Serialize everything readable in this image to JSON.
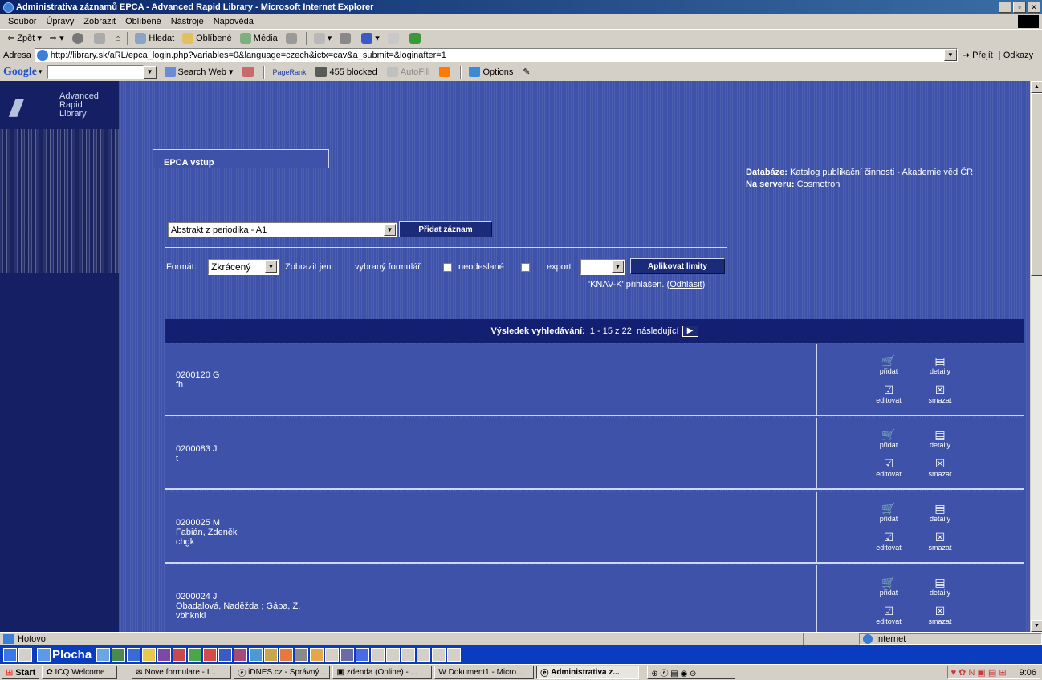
{
  "window": {
    "title": "Administrativa záznamů EPCA - Advanced Rapid Library - Microsoft Internet Explorer"
  },
  "menu": [
    "Soubor",
    "Úpravy",
    "Zobrazit",
    "Oblíbené",
    "Nástroje",
    "Nápověda"
  ],
  "toolbar": {
    "back": "Zpět",
    "search": "Hledat",
    "favorites": "Oblíbené",
    "media": "Média"
  },
  "address": {
    "label": "Adresa",
    "url": "http://library.sk/aRL/epca_login.php?variables=0&language=czech&ictx=cav&a_submit=&loginafter=1",
    "go": "Přejít",
    "links": "Odkazy"
  },
  "google": {
    "logo": "Google",
    "search_web": "Search Web",
    "pagerank": "PageRank",
    "blocked": "455 blocked",
    "autofill": "AutoFill",
    "options": "Options"
  },
  "sidebar": {
    "logo_lines": [
      "Advanced",
      "Rapid",
      "Library"
    ]
  },
  "page": {
    "tab": "EPCA vstup",
    "db_label": "Databáze:",
    "db_value": "Katalog publikační činnosti - Akademie věd ČR",
    "server_label": "Na serveru:",
    "server_value": "Cosmotron",
    "record_type": "Abstrakt z periodika - A1",
    "add_record": "Přidat záznam",
    "format_label": "Formát:",
    "format_value": "Zkrácený",
    "show_only": "Zobrazit jen:",
    "selected_form": "vybraný formulář",
    "unsent": "neodeslané",
    "export": "export",
    "apply_limits": "Aplikovat limity",
    "login_status": "'KNAV-K' přihlášen.",
    "logout": "Odhlásit",
    "results_label": "Výsledek vyhledávání:",
    "results_range": "1 - 15  z 22",
    "next": "následující"
  },
  "actions": {
    "add": "přidat",
    "details": "detaily",
    "edit": "editovat",
    "delete": "smazat"
  },
  "records": [
    {
      "id": "0200120 G",
      "line2": "fh",
      "line3": ""
    },
    {
      "id": "0200083 J",
      "line2": "t",
      "line3": ""
    },
    {
      "id": "0200025 M",
      "line2": "Fabián, Zdeněk",
      "line3": "chgk"
    },
    {
      "id": "0200024 J",
      "line2": "Obadalová, Naděžda ; Gába, Z.",
      "line3": "vbhknkl"
    }
  ],
  "status": {
    "text": "Hotovo",
    "zone": "Internet"
  },
  "quicklaunch": {
    "desktop": "Plocha"
  },
  "taskbar": {
    "start": "Start",
    "tasks": [
      "ICQ Welcome",
      "Nove formulare - I...",
      "iDNES.cz - Správný...",
      "zdenda (Online) - ...",
      "Dokument1 - Micro...",
      "Administrativa z..."
    ],
    "clock": "9:06"
  }
}
